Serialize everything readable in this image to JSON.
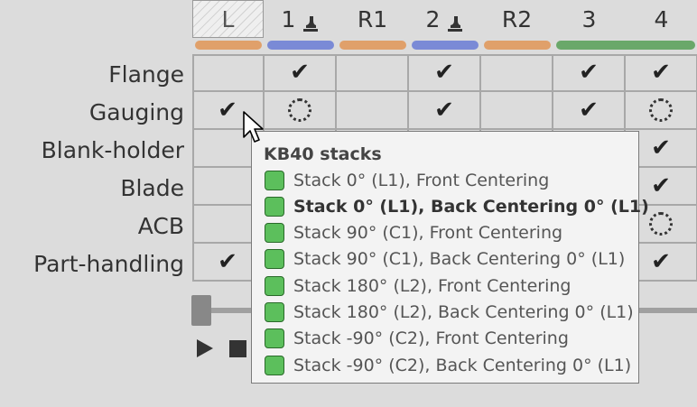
{
  "columns": [
    {
      "label": "L",
      "tool": false,
      "color": "#e0a06a",
      "selected": true
    },
    {
      "label": "1",
      "tool": true,
      "color": "#7a8ad6",
      "selected": false
    },
    {
      "label": "R1",
      "tool": false,
      "color": "#e0a06a",
      "selected": false
    },
    {
      "label": "2",
      "tool": true,
      "color": "#7a8ad6",
      "selected": false
    },
    {
      "label": "R2",
      "tool": false,
      "color": "#e0a06a",
      "selected": false
    },
    {
      "label": "3",
      "tool": false,
      "color": "#6aa86a",
      "selected": false
    },
    {
      "label": "4",
      "tool": false,
      "color": "#6aa86a",
      "selected": false
    }
  ],
  "rows": [
    {
      "label": "Flange",
      "cells": [
        "",
        "check",
        "",
        "check",
        "",
        "check",
        "check"
      ]
    },
    {
      "label": "Gauging",
      "cells": [
        "check",
        "dotted",
        "",
        "check",
        "",
        "check",
        "dotted"
      ]
    },
    {
      "label": "Blank-holder",
      "cells": [
        "",
        "",
        "",
        "",
        "",
        "",
        "check"
      ]
    },
    {
      "label": "Blade",
      "cells": [
        "",
        "",
        "",
        "",
        "",
        "",
        "check"
      ]
    },
    {
      "label": "ACB",
      "cells": [
        "",
        "",
        "",
        "",
        "",
        "",
        "dotted"
      ]
    },
    {
      "label": "Part-handling",
      "cells": [
        "check",
        "",
        "",
        "",
        "",
        "",
        "check"
      ]
    }
  ],
  "tooltip": {
    "title": "KB40 stacks",
    "items": [
      {
        "label": "Stack 0° (L1), Front Centering",
        "bold": false
      },
      {
        "label": "Stack 0° (L1), Back Centering 0° (L1)",
        "bold": true
      },
      {
        "label": "Stack 90° (C1), Front Centering",
        "bold": false
      },
      {
        "label": "Stack 90° (C1), Back Centering 0° (L1)",
        "bold": false
      },
      {
        "label": "Stack 180° (L2), Front Centering",
        "bold": false
      },
      {
        "label": "Stack 180° (L2), Back Centering 0° (L1)",
        "bold": false
      },
      {
        "label": "Stack -90° (C2), Front Centering",
        "bold": false
      },
      {
        "label": "Stack -90° (C2), Back Centering 0° (L1)",
        "bold": false
      }
    ]
  },
  "icons": {
    "check": "✔",
    "play": "play-icon",
    "stop": "stop-icon",
    "tool": "tool-icon",
    "cursor": "mouse-cursor-icon"
  }
}
